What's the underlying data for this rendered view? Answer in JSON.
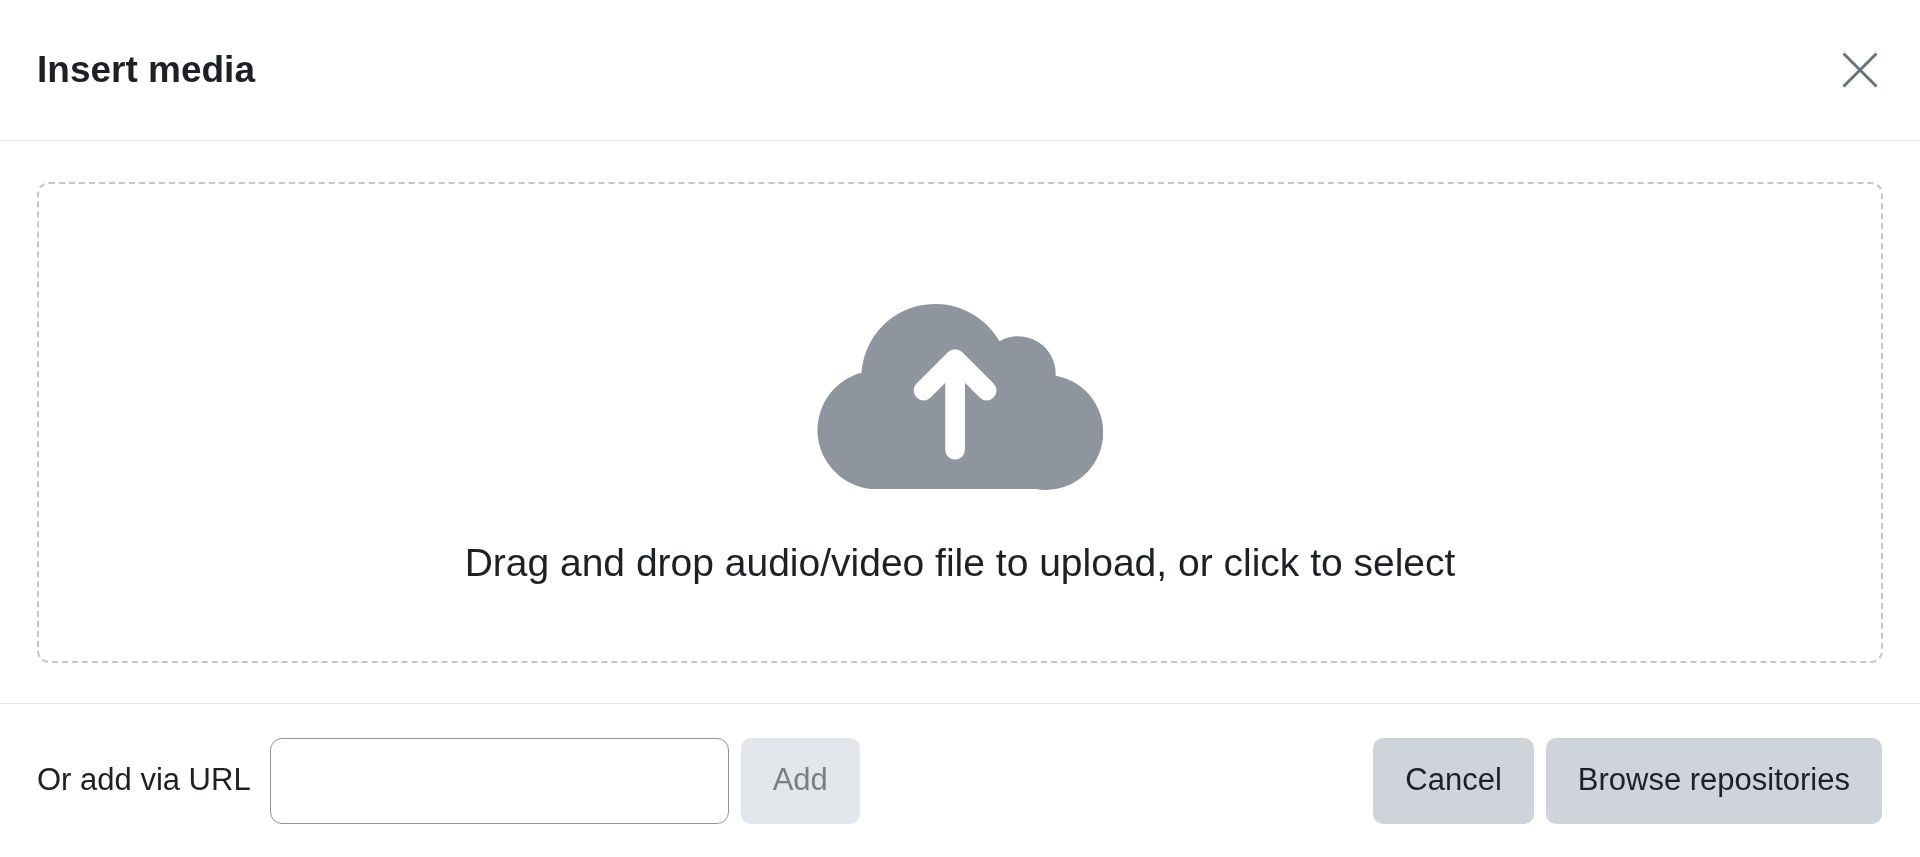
{
  "dialog": {
    "title": "Insert media"
  },
  "dropzone": {
    "message": "Drag and drop audio/video file to upload, or click to select"
  },
  "footer": {
    "url_label": "Or add via URL",
    "buttons": [
      {
        "label": "Add",
        "disabled": true
      },
      {
        "label": "Cancel",
        "disabled": false
      },
      {
        "label": "Browse repositories",
        "disabled": false
      }
    ]
  }
}
